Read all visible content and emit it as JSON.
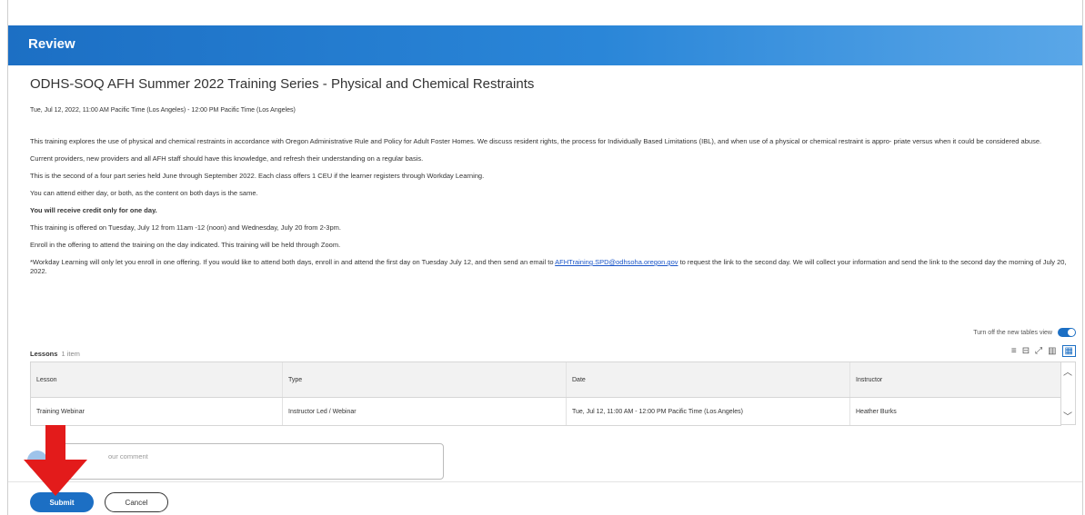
{
  "header": {
    "title": "Review"
  },
  "course": {
    "title": "ODHS-SOQ AFH Summer 2022 Training Series - Physical and Chemical Restraints",
    "datetime": "Tue, Jul 12, 2022, 11:00 AM Pacific Time (Los Angeles)  -  12:00 PM Pacific Time (Los Angeles)"
  },
  "description": {
    "p1": "This training explores the use of physical and chemical restraints in accordance with Oregon Administrative Rule and Policy for Adult Foster Homes. We discuss resident rights, the process for Individually Based Limitations (IBL), and when use of a physical or chemical restraint is appro- priate versus when it could be considered abuse.",
    "p2": "Current providers, new providers and all AFH staff should have this knowledge, and refresh their understanding on a regular basis.",
    "p3": "This is the second of a four part series held June through September 2022. Each class offers 1 CEU if the learner registers through Workday Learning.",
    "p4": "You can attend either day, or both, as the content on both days is the same.",
    "p5": "You will receive credit only for one day.",
    "p6": "This training is offered on Tuesday, July 12 from 11am -12 (noon) and Wednesday, July 20 from 2-3pm.",
    "p7": "Enroll in the offering to attend the training on the day indicated. This training will be held through Zoom.",
    "p8_before": "*Workday Learning will only let you enroll in one offering. If you would like to attend both days, enroll in and attend the first day on Tuesday July 12, and then send an email to ",
    "p8_link": "AFHTraining.SPD@odhsoha.oregon.gov",
    "p8_after": " to request the link to the second day. We will collect your information and send the link to the second day the morning of July 20, 2022."
  },
  "table_toggle": {
    "label": "Turn off the new tables view"
  },
  "lessons": {
    "label": "Lessons",
    "count": "1 item",
    "columns": [
      "Lesson",
      "Type",
      "Date",
      "Instructor"
    ],
    "rows": [
      [
        "Training Webinar",
        "Instructor Led / Webinar",
        "Tue, Jul 12, 11:00 AM  -  12:00 PM Pacific Time (Los Angeles)",
        "Heather Burks"
      ]
    ]
  },
  "comment": {
    "placeholder": "our comment"
  },
  "actions": {
    "submit": "Submit",
    "cancel": "Cancel"
  },
  "colors": {
    "brand": "#1c6fc4",
    "arrow": "#e31b1b"
  }
}
